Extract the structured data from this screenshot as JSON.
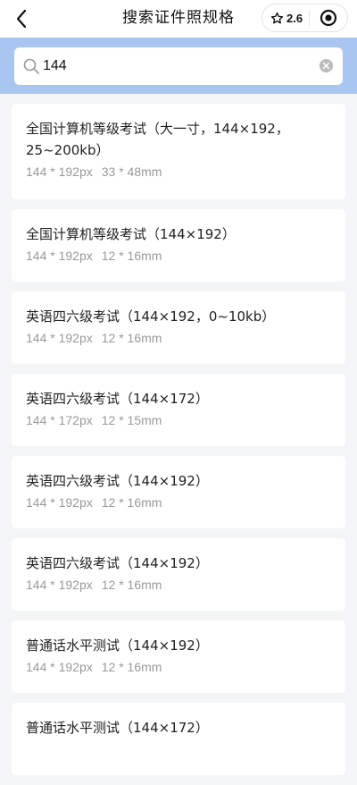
{
  "nav": {
    "title": "搜索证件照规格",
    "rating": "2.6"
  },
  "search": {
    "value": "144",
    "placeholder": ""
  },
  "results": [
    {
      "name": "全国计算机等级考试（大一寸，144×192，25~200kb）",
      "px": "144 * 192px",
      "mm": "33 * 48mm"
    },
    {
      "name": "全国计算机等级考试（144×192）",
      "px": "144 * 192px",
      "mm": "12 * 16mm"
    },
    {
      "name": "英语四六级考试（144×192，0~10kb）",
      "px": "144 * 192px",
      "mm": "12 * 16mm"
    },
    {
      "name": "英语四六级考试（144×172）",
      "px": "144 * 172px",
      "mm": "12 * 15mm"
    },
    {
      "name": "英语四六级考试（144×192）",
      "px": "144 * 192px",
      "mm": "12 * 16mm"
    },
    {
      "name": "英语四六级考试（144×192）",
      "px": "144 * 192px",
      "mm": "12 * 16mm"
    },
    {
      "name": "普通话水平测试（144×192）",
      "px": "144 * 192px",
      "mm": "12 * 16mm"
    },
    {
      "name": "普通话水平测试（144×172）",
      "px": "",
      "mm": ""
    }
  ],
  "colors": {
    "search_band": "#a8c6f0",
    "page_bg": "#f4f5f7",
    "secondary_text": "#999999"
  }
}
